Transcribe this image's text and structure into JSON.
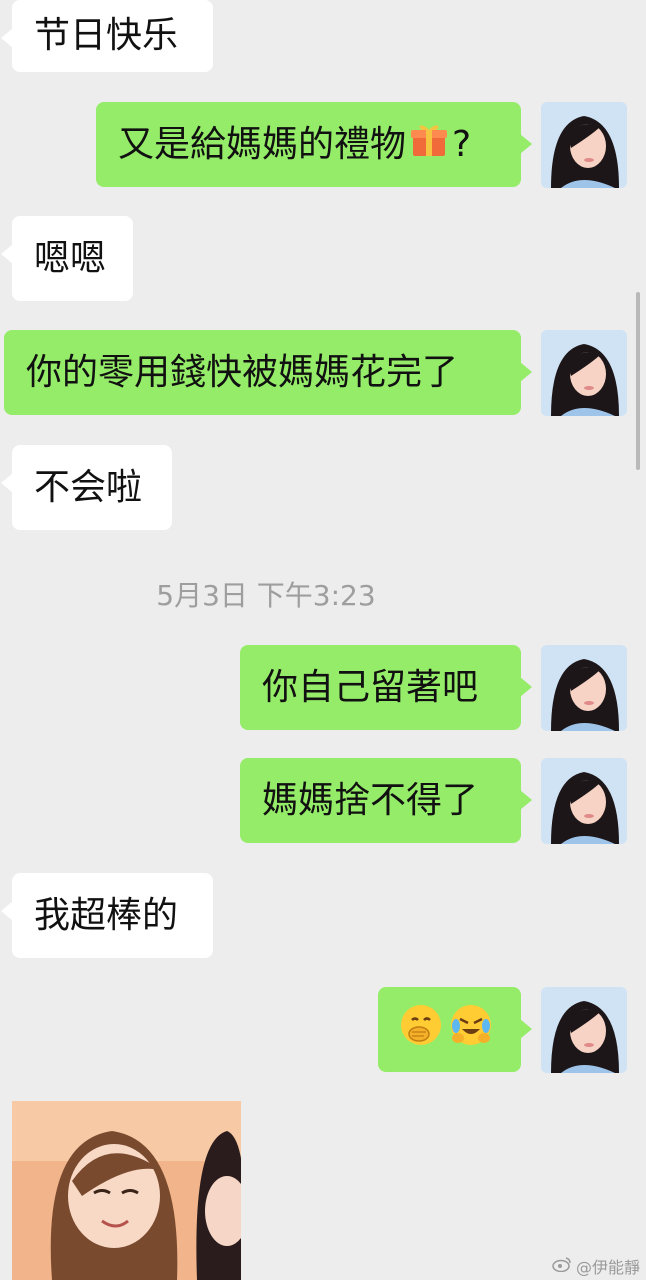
{
  "messages": [
    {
      "side": "in",
      "text": "节日快乐"
    },
    {
      "side": "out",
      "text": "又是給媽媽的禮物",
      "suffix": "?",
      "emoji": "gift-icon"
    },
    {
      "side": "in",
      "text": "嗯嗯"
    },
    {
      "side": "out",
      "text": "你的零用錢快被媽媽花完了"
    },
    {
      "side": "in",
      "text": "不会啦"
    },
    {
      "side": "out",
      "text": "你自己留著吧"
    },
    {
      "side": "out",
      "text": "媽媽捨不得了"
    },
    {
      "side": "in",
      "text": "我超棒的"
    },
    {
      "side": "out",
      "emoji": [
        "hand-over-mouth-emoji",
        "laughing-crying-emoji"
      ]
    }
  ],
  "timestamp": "5月3日 下午3:23",
  "watermark": "@伊能靜",
  "colors": {
    "background": "#ededed",
    "incoming": "#ffffff",
    "outgoing": "#95ec69"
  }
}
